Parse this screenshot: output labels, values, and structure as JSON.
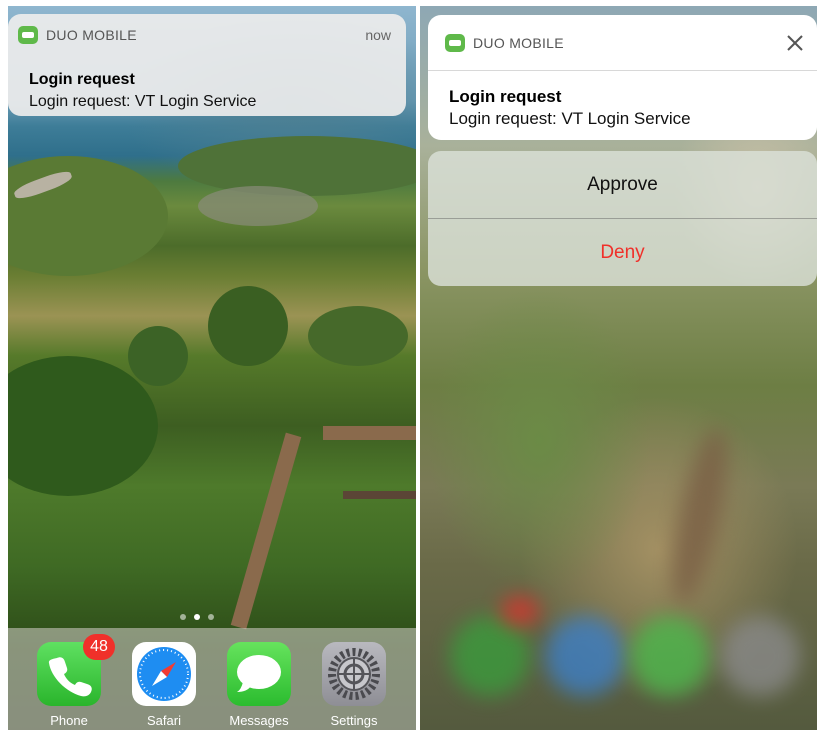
{
  "left": {
    "notification": {
      "app_name": "DUO MOBILE",
      "time": "now",
      "title": "Login request",
      "body": "Login request: VT Login Service"
    },
    "dock": [
      {
        "label": "Phone",
        "badge": "48"
      },
      {
        "label": "Safari"
      },
      {
        "label": "Messages"
      },
      {
        "label": "Settings"
      }
    ]
  },
  "right": {
    "notification": {
      "app_name": "DUO MOBILE",
      "title": "Login request",
      "body": "Login request: VT Login Service"
    },
    "actions": {
      "approve": "Approve",
      "deny": "Deny"
    }
  },
  "colors": {
    "duo_green": "#5fb94a",
    "deny_red": "#f0302a",
    "badge_red": "#f0302a"
  }
}
